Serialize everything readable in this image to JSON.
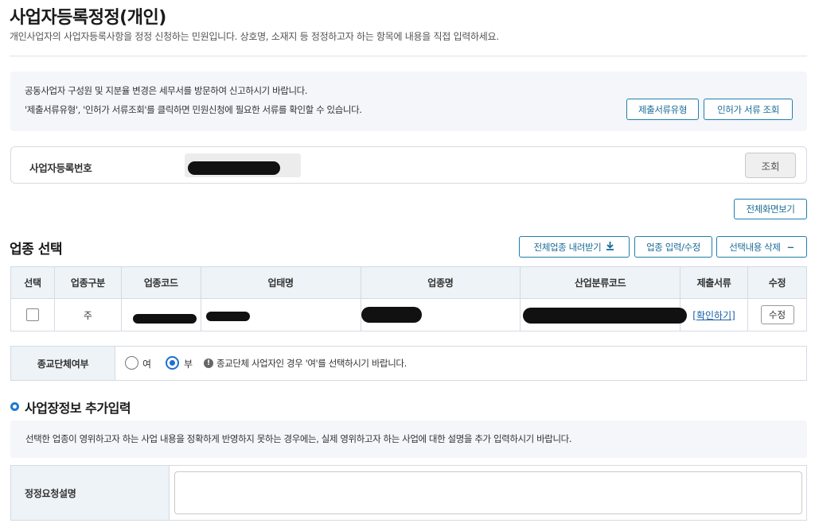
{
  "page": {
    "title": "사업자등록정정(개인)",
    "subtitle": "개인사업자의 사업자등록사항을 정정 신청하는 민원입니다. 상호명, 소재지 등 정정하고자 하는 항목에 내용을 직접 입력하세요."
  },
  "notice": {
    "line1": "공동사업자 구성원 및 지분율 변경은 세무서를 방문하여 신고하시기 바랍니다.",
    "line2": "'제출서류유형', '인허가 서류조회'를 클릭하면 민원신청에 필요한 서류를 확인할 수 있습니다.",
    "doc_type_button": "제출서류유형",
    "permit_lookup_button": "인허가 서류 조회"
  },
  "business_number": {
    "label": "사업자등록번호",
    "value": "",
    "lookup_button": "조회"
  },
  "fullscreen_button": "전체화면보기",
  "industry": {
    "title": "업종 선택",
    "download_button": "전체업종 내려받기",
    "edit_button": "업종 입력/수정",
    "delete_button": "선택내용 삭제",
    "columns": [
      "선택",
      "업종구분",
      "업종코드",
      "업태명",
      "업종명",
      "산업분류코드",
      "제출서류",
      "수정"
    ],
    "rows": [
      {
        "type": "주",
        "code": "",
        "business_type": "",
        "industry_name": "",
        "class_code": "",
        "docs_link": "[확인하기]",
        "edit_button": "수정"
      }
    ]
  },
  "religion": {
    "label": "종교단체여부",
    "option_yes": "여",
    "option_no": "부",
    "selected": "부",
    "hint": "종교단체 사업자인 경우 '여'를 선택하시기 바랍니다."
  },
  "additional": {
    "title": "사업장정보 추가입력",
    "description": "선택한 업종이 영위하고자 하는 사업 내용을 정확하게 반영하지 못하는 경우에는, 실제 영위하고자 하는 사업에 대한 설명을 추가 입력하시기 바랍니다.",
    "request_label": "정정요청설명",
    "request_value": ""
  }
}
